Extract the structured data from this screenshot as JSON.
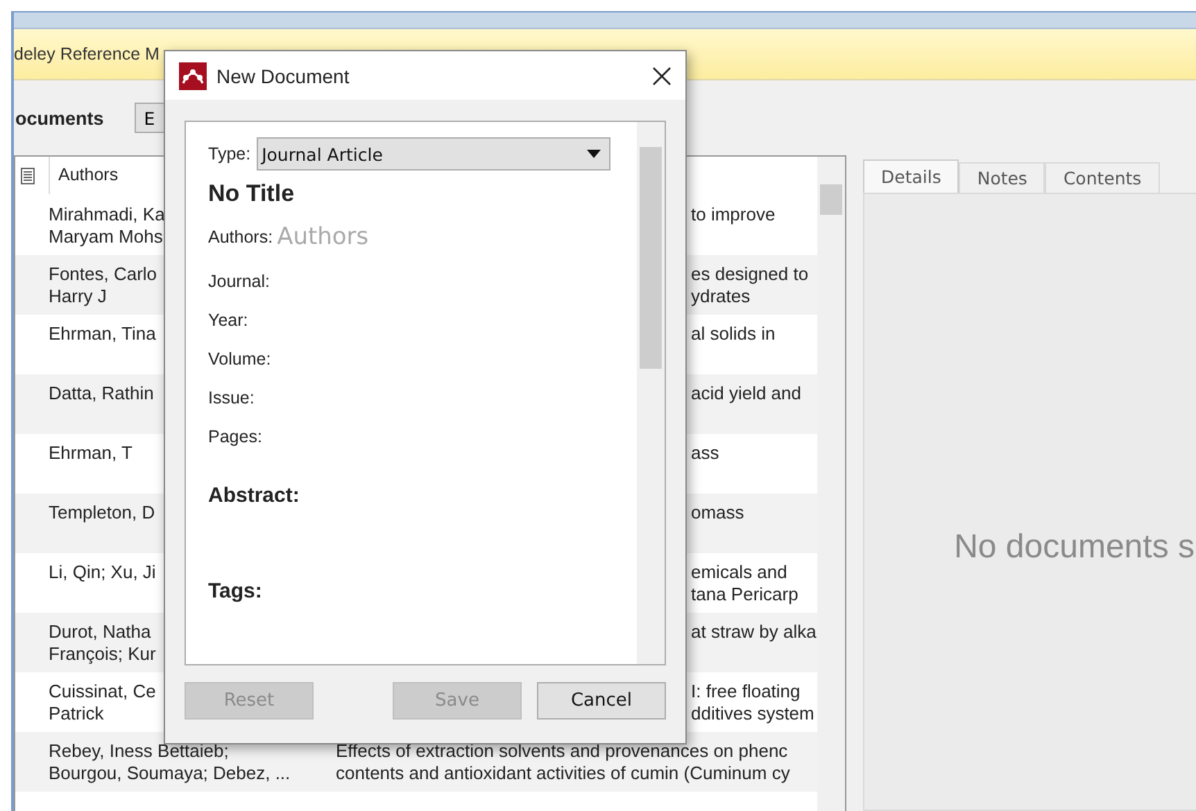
{
  "app": {
    "banner": "deley Reference M",
    "section_title": "ocuments",
    "toolbar_button": "E"
  },
  "table": {
    "columns": [
      "Authors"
    ],
    "rows": [
      {
        "kind": "covered",
        "authors": "Mirahmadi, Ka\nMaryam Mohs",
        "title": "to improve"
      },
      {
        "kind": "covered",
        "authors": "Fontes, Carlo\nHarry J",
        "title": "es designed to\nydrates"
      },
      {
        "kind": "covered",
        "authors": "Ehrman, Tina",
        "title": "al solids in"
      },
      {
        "kind": "covered",
        "authors": "Datta, Rathin",
        "title": "acid yield and"
      },
      {
        "kind": "covered",
        "authors": "Ehrman, T",
        "title": "ass"
      },
      {
        "kind": "covered",
        "authors": "Templeton, D",
        "title": "omass"
      },
      {
        "kind": "covered",
        "authors": "Li, Qin; Xu, Ji",
        "title": "emicals and\ntana Pericarp"
      },
      {
        "kind": "covered",
        "authors": "Durot, Natha\nFrançois; Kur",
        "title": "at straw by alka"
      },
      {
        "kind": "covered",
        "authors": "Cuissinat, Ce\nPatrick",
        "title": "I: free floating\ndditives system"
      },
      {
        "kind": "full",
        "authors": "Rebey, Iness Bettaieb;\nBourgou, Soumaya; Debez, ...",
        "title": "Effects of extraction solvents and provenances on phenc\ncontents and antioxidant activities of cumin (Cuminum cy"
      }
    ]
  },
  "details": {
    "tabs": [
      {
        "label": "Details",
        "selected": true
      },
      {
        "label": "Notes",
        "selected": false
      },
      {
        "label": "Contents",
        "selected": false
      }
    ],
    "message": "No documents s"
  },
  "dialog": {
    "title": "New Document",
    "type_label": "Type:",
    "type_value": "Journal Article",
    "doc_title": "No Title",
    "authors_label": "Authors:",
    "authors_placeholder": "Authors",
    "fields": [
      "Journal:",
      "Year:",
      "Volume:",
      "Issue:",
      "Pages:"
    ],
    "sections": [
      "Abstract:",
      "Tags:"
    ],
    "buttons": [
      {
        "label": "Reset",
        "disabled": true
      },
      {
        "label": "Save",
        "disabled": true
      },
      {
        "label": "Cancel",
        "disabled": false
      }
    ]
  }
}
